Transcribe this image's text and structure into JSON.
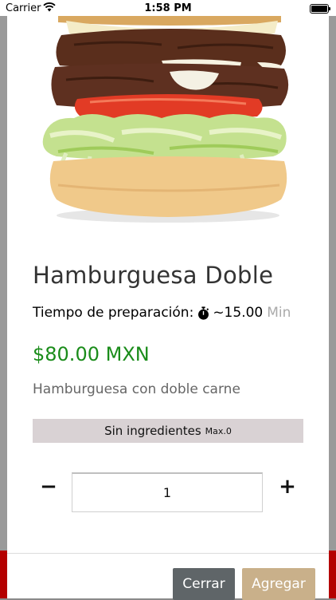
{
  "status_bar": {
    "carrier": "Carrier",
    "time": "1:58 PM"
  },
  "product": {
    "title": "Hamburguesa Doble",
    "prep_label": "Tiempo de preparación:",
    "prep_time": "~15.00",
    "prep_unit": "Min",
    "price": "$80.00 MXN",
    "description": "Hamburguesa con doble carne"
  },
  "ingredients": {
    "label": "Sin ingredientes",
    "max": "Max.0"
  },
  "quantity": {
    "value": "1",
    "minus": "−",
    "plus": "+"
  },
  "actions": {
    "close_label": "Cerrar",
    "add_label": "Agregar"
  },
  "colors": {
    "price": "#1a8c1a",
    "close_button": "#5f6568",
    "add_button": "#c9b08a",
    "ingredients_bar": "#d9d2d4"
  },
  "icons": [
    "wifi-icon",
    "battery-icon",
    "stopwatch-icon",
    "burger-image"
  ]
}
